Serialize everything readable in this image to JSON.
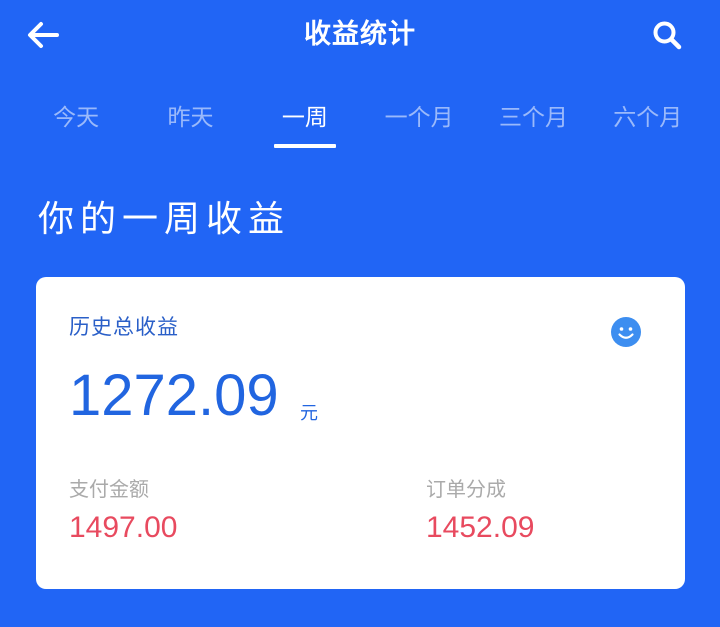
{
  "header": {
    "title": "收益统计",
    "back_icon": "arrow-left-icon",
    "search_icon": "search-icon"
  },
  "tabs": [
    {
      "label": "今天",
      "active": false
    },
    {
      "label": "昨天",
      "active": false
    },
    {
      "label": "一周",
      "active": true
    },
    {
      "label": "一个月",
      "active": false
    },
    {
      "label": "三个月",
      "active": false
    },
    {
      "label": "六个月",
      "active": false
    }
  ],
  "heading": "你的一周收益",
  "card": {
    "title": "历史总收益",
    "icon": "smile-icon",
    "amount": "1272.09",
    "unit": "元",
    "metrics": [
      {
        "label": "支付金额",
        "value": "1497.00"
      },
      {
        "label": "订单分成",
        "value": "1452.09"
      }
    ]
  },
  "colors": {
    "background": "#2165f5",
    "amount": "#2165e0",
    "metric_value": "#e84a5f"
  }
}
